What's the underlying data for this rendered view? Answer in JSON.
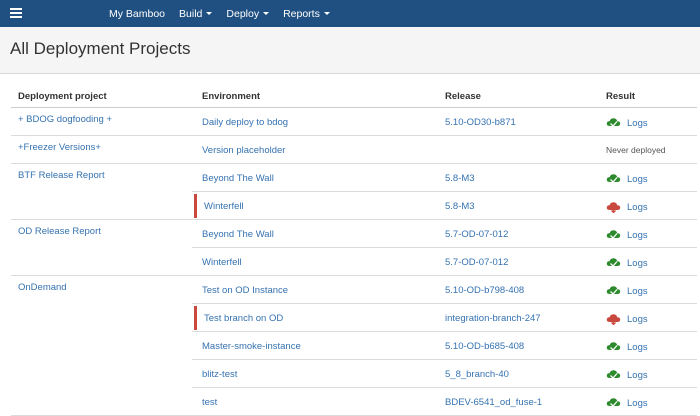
{
  "nav": {
    "home": "My Bamboo",
    "build": "Build",
    "deploy": "Deploy",
    "reports": "Reports"
  },
  "page": {
    "title": "All Deployment Projects"
  },
  "table": {
    "headers": {
      "project": "Deployment project",
      "environment": "Environment",
      "release": "Release",
      "result": "Result"
    },
    "rows": [
      {
        "project": "+ BDOG dogfooding +",
        "environment": "Daily deploy to bdog",
        "release": "5.10-OD30-b871",
        "status": "success",
        "result": "Logs"
      },
      {
        "project": "+Freezer Versions+",
        "environment": "Version placeholder",
        "release": "",
        "status": "none",
        "result": "Never deployed"
      },
      {
        "project": "BTF Release Report",
        "environment": "Beyond The Wall",
        "release": "5.8-M3",
        "status": "success",
        "result": "Logs"
      },
      {
        "project": "",
        "environment": "Winterfell",
        "release": "5.8-M3",
        "status": "failed",
        "result": "Logs"
      },
      {
        "project": "OD Release Report",
        "environment": "Beyond The Wall",
        "release": "5.7-OD-07-012",
        "status": "success",
        "result": "Logs"
      },
      {
        "project": "",
        "environment": "Winterfell",
        "release": "5.7-OD-07-012",
        "status": "success",
        "result": "Logs"
      },
      {
        "project": "OnDemand",
        "environment": "Test on OD Instance",
        "release": "5.10-OD-b798-408",
        "status": "success",
        "result": "Logs"
      },
      {
        "project": "",
        "environment": "Test branch on OD",
        "release": "integration-branch-247",
        "status": "failed",
        "result": "Logs"
      },
      {
        "project": "",
        "environment": "Master-smoke-instance",
        "release": "5.10-OD-b685-408",
        "status": "success",
        "result": "Logs"
      },
      {
        "project": "",
        "environment": "blitz-test",
        "release": "5_8_branch-40",
        "status": "success",
        "result": "Logs"
      },
      {
        "project": "",
        "environment": "test",
        "release": "BDEV-6541_od_fuse-1",
        "status": "success",
        "result": "Logs"
      }
    ]
  },
  "colors": {
    "topbar": "#205081",
    "link": "#3572b0",
    "success": "#2d8a2d",
    "failed": "#c9493f"
  }
}
